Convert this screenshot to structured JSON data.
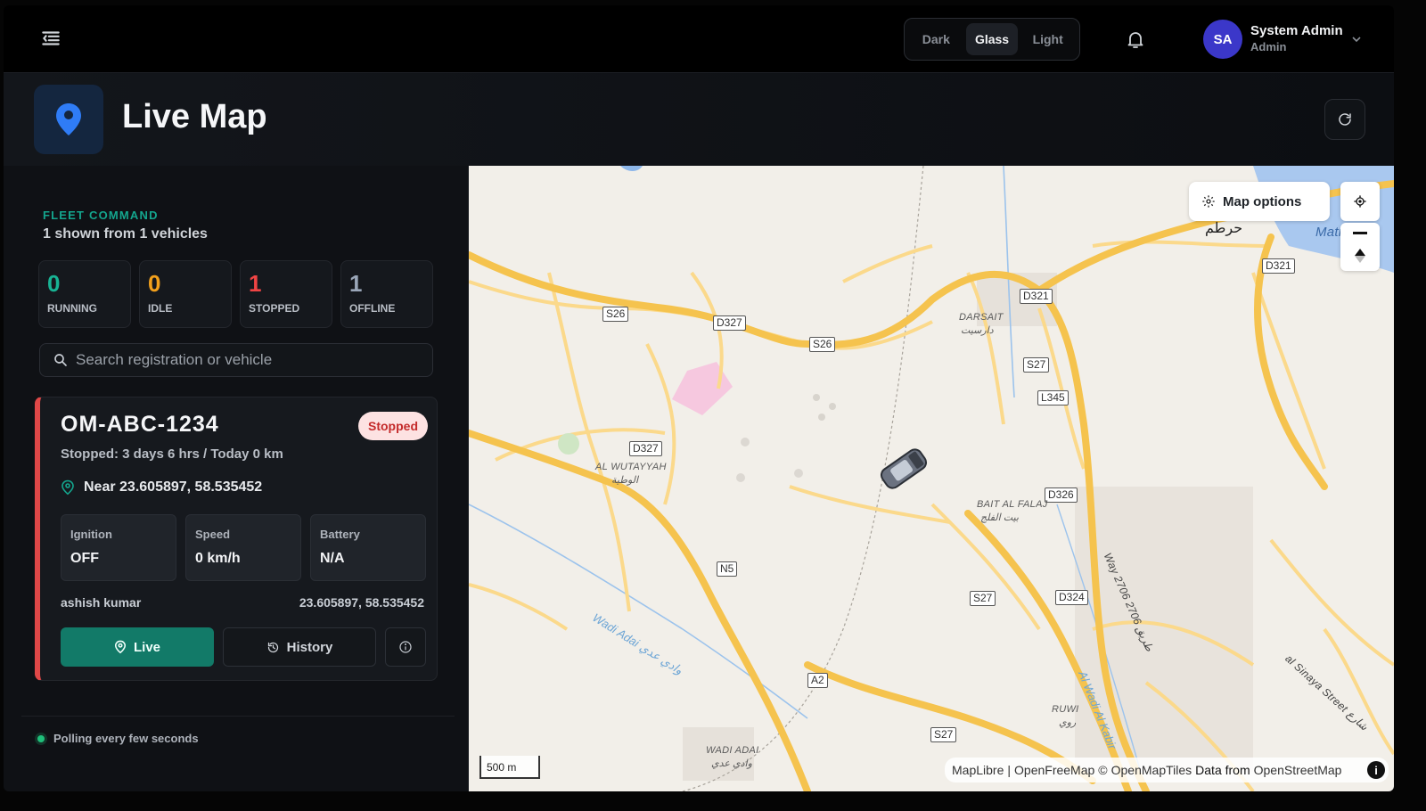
{
  "topbar": {
    "theme_options": [
      "Dark",
      "Glass",
      "Light"
    ],
    "active_theme": "Glass",
    "user": {
      "initials": "SA",
      "name": "System Admin",
      "role": "Admin"
    }
  },
  "header": {
    "title": "Live Map"
  },
  "sidebar": {
    "kicker": "FLEET COMMAND",
    "shown_text": "1 shown from 1 vehicles",
    "stats": [
      {
        "value": "0",
        "label": "RUNNING",
        "color": "#18b394"
      },
      {
        "value": "0",
        "label": "IDLE",
        "color": "#f2a01c"
      },
      {
        "value": "1",
        "label": "STOPPED",
        "color": "#ef4444"
      },
      {
        "value": "1",
        "label": "OFFLINE",
        "color": "#9aa6b8"
      }
    ],
    "search_placeholder": "Search registration or vehicle",
    "vehicle": {
      "plate": "OM-ABC-1234",
      "status_badge": "Stopped",
      "status_line": "Stopped: 3 days 6 hrs / Today 0 km",
      "location": "Near 23.605897, 58.535452",
      "metrics": [
        {
          "label": "Ignition",
          "value": "OFF"
        },
        {
          "label": "Speed",
          "value": "0 km/h"
        },
        {
          "label": "Battery",
          "value": "N/A"
        }
      ],
      "driver": "ashish kumar",
      "coords": "23.605897, 58.535452",
      "live_label": "Live",
      "history_label": "History"
    },
    "polling_text": "Polling every few seconds"
  },
  "map": {
    "options_label": "Map options",
    "scale": "500 m",
    "attribution": [
      "MapLibre",
      "|",
      "OpenFreeMap",
      "©",
      "OpenMapTiles",
      "Data from",
      "OpenStreetMap"
    ],
    "road_labels": [
      "S26",
      "D327",
      "S26",
      "D321",
      "S27",
      "L345",
      "D327",
      "D326",
      "N5",
      "S27",
      "D324",
      "A2",
      "S27",
      "D321"
    ],
    "places": [
      "DARSAIT",
      "دارسيت",
      "AL WUTAYYAH",
      "الوطية",
      "BAIT AL FALAJ",
      "بيت الفلج",
      "RUWI",
      "روي",
      "WADI ADAI",
      "وادي عدي",
      "حرطم",
      "Matra"
    ],
    "waterways": [
      "Wadi Adai وادي عدي",
      "Al Wadi Al Kabir",
      "Way 2706 طريق 2706",
      "al Sinaya Street شارع"
    ]
  }
}
